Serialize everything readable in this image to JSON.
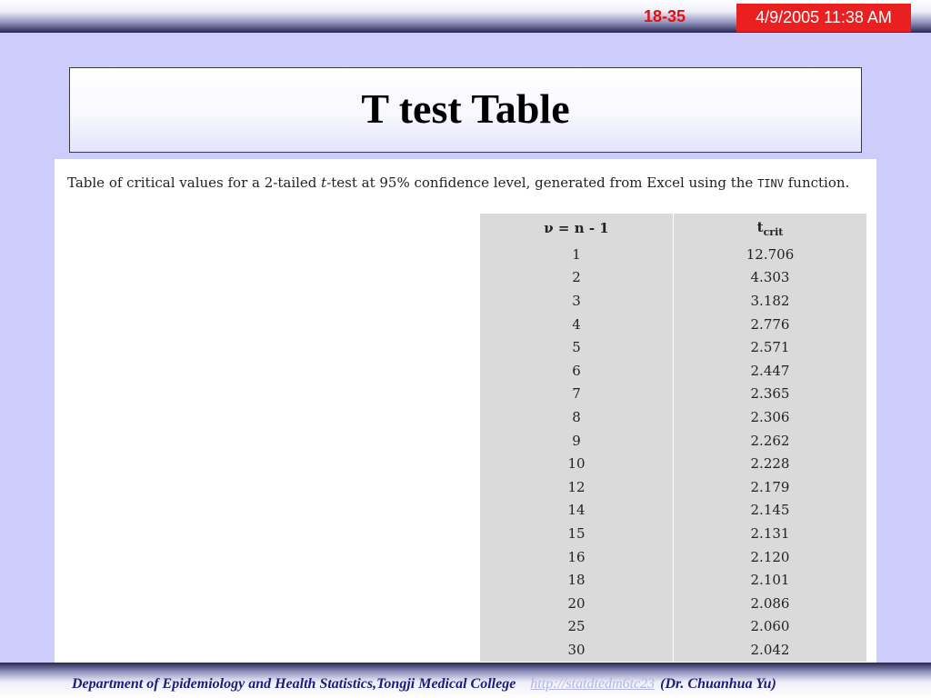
{
  "header": {
    "slide_number": "18-35",
    "datetime": "4/9/2005 11:38 AM"
  },
  "title": "T test Table",
  "caption": {
    "prefix": "Table of critical values for a 2-tailed ",
    "t": "t",
    "middle": "-test at 95% confidence level, generated from Excel using the ",
    "func": "TINV",
    "suffix": " function."
  },
  "table": {
    "col1_header": "ν = n - 1",
    "col2_header": "t",
    "col2_header_sub": "crit",
    "rows": [
      [
        "1",
        "12.706"
      ],
      [
        "2",
        "4.303"
      ],
      [
        "3",
        "3.182"
      ],
      [
        "4",
        "2.776"
      ],
      [
        "5",
        "2.571"
      ],
      [
        "6",
        "2.447"
      ],
      [
        "7",
        "2.365"
      ],
      [
        "8",
        "2.306"
      ],
      [
        "9",
        "2.262"
      ],
      [
        "10",
        "2.228"
      ],
      [
        "12",
        "2.179"
      ],
      [
        "14",
        "2.145"
      ],
      [
        "15",
        "2.131"
      ],
      [
        "16",
        "2.120"
      ],
      [
        "18",
        "2.101"
      ],
      [
        "20",
        "2.086"
      ],
      [
        "25",
        "2.060"
      ],
      [
        "30",
        "2.042"
      ]
    ]
  },
  "footer": {
    "department": "Department of Epidemiology and Health Statistics,Tongji Medical College",
    "link": "http://statdtedm6tc23",
    "author": "(Dr. Chuanhua Yu)"
  },
  "colors": {
    "slide_background": "#cdcdfb",
    "accent_red": "#ea1f1f",
    "footer_text": "#1c1c7a"
  }
}
